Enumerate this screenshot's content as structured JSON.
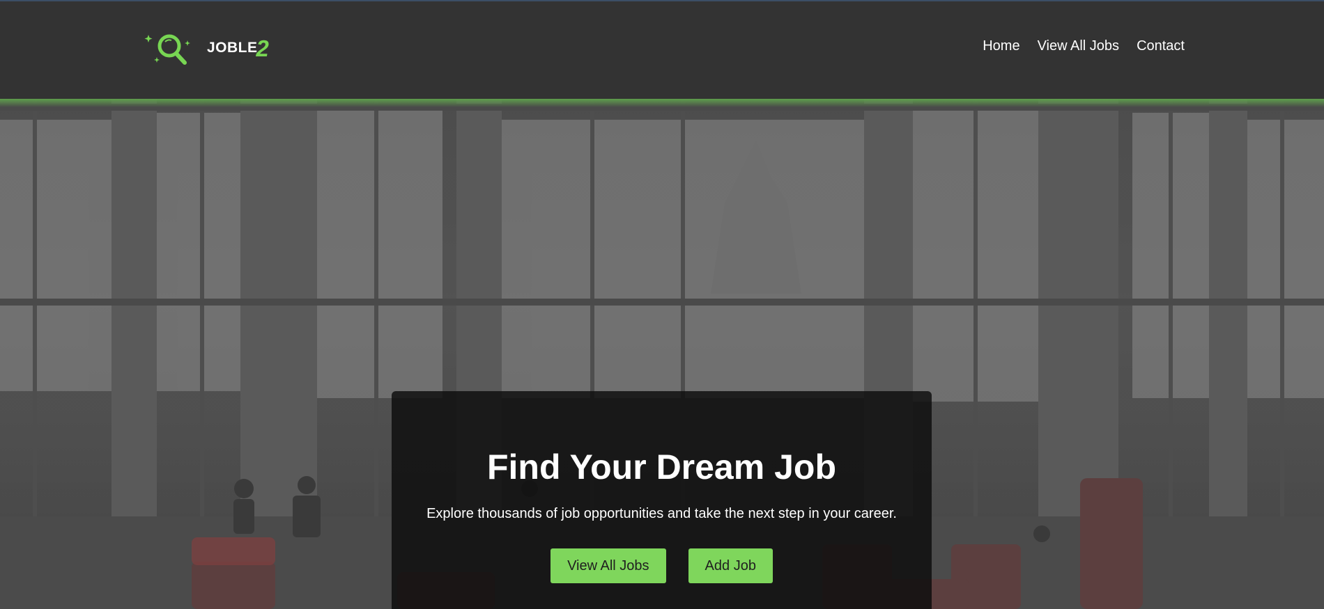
{
  "brand": {
    "word": "JOBLE",
    "number": "2",
    "accent": "#78d653"
  },
  "nav": {
    "items": [
      {
        "label": "Home"
      },
      {
        "label": "View All Jobs"
      },
      {
        "label": "Contact"
      }
    ]
  },
  "hero": {
    "title": "Find Your Dream Job",
    "subtitle": "Explore thousands of job opportunities and take the next step in your career.",
    "buttons": [
      {
        "label": "View All Jobs"
      },
      {
        "label": "Add Job"
      }
    ],
    "button_color": "#7fd65c"
  },
  "icons": {
    "logo": "magnifier-sparkle-icon"
  }
}
